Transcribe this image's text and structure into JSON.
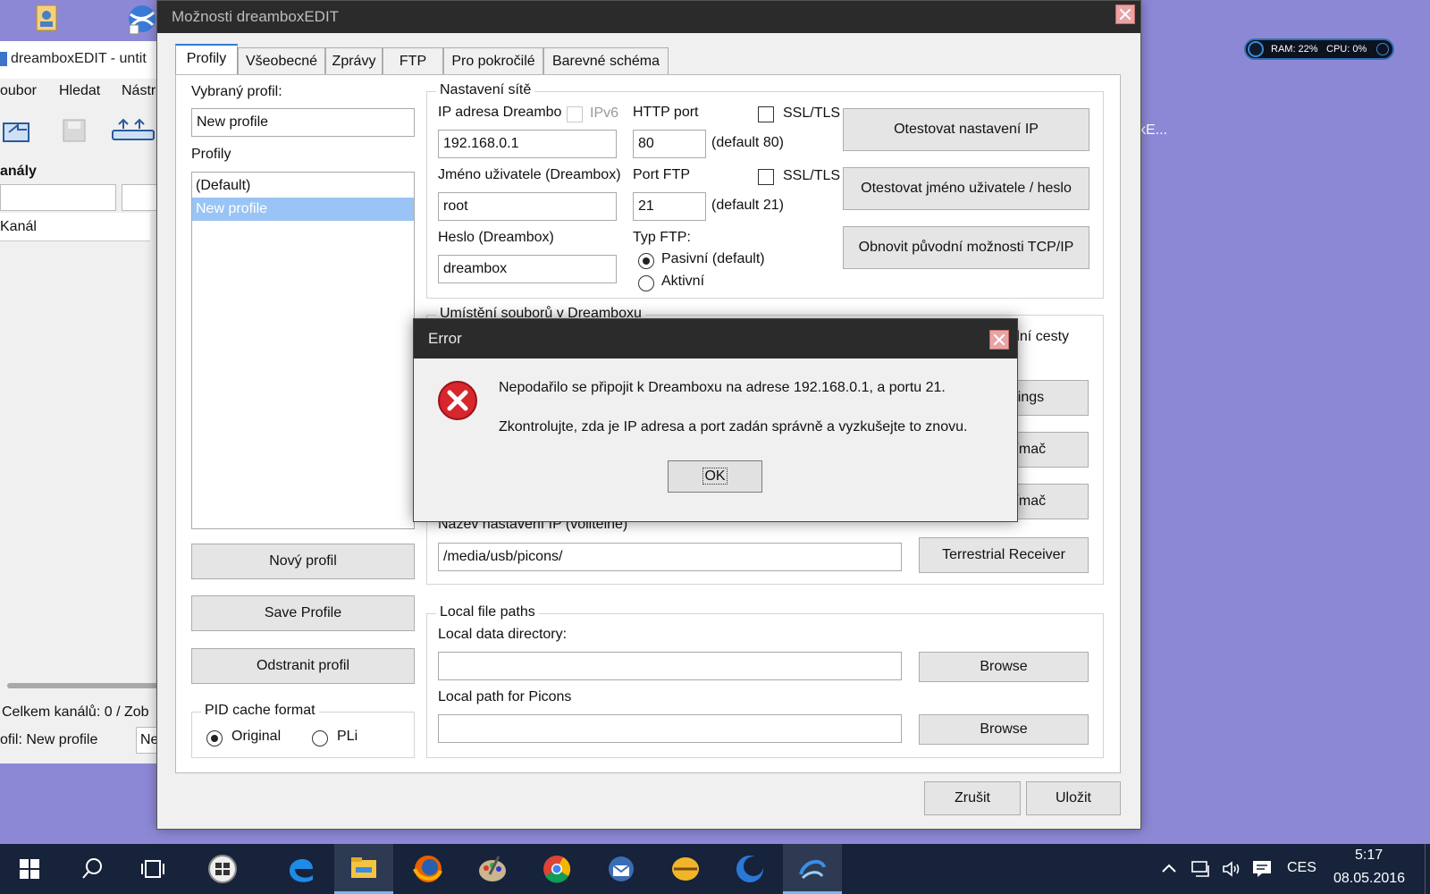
{
  "sysmon": {
    "ram": "RAM: 22%",
    "cpu": "CPU: 0%"
  },
  "desktop": {
    "partial_text": "kE..."
  },
  "bg_app": {
    "title": "dreamboxEDIT - untit",
    "menu": [
      "oubor",
      "Hledat",
      "Nástr"
    ],
    "section": "anály",
    "column": "Kanál",
    "status1": "Celkem kanálů: 0  /  Zob",
    "status2": "ofil: New profile",
    "status2b": "Ne"
  },
  "dialog": {
    "title": "Možnosti dreamboxEDIT",
    "tabs": [
      "Profily",
      "Všeobecné",
      "Zprávy",
      "FTP",
      "Pro pokročilé",
      "Barevné schéma"
    ],
    "selected_profile_label": "Vybraný profil:",
    "selected_profile_value": "New profile",
    "profiles_label": "Profily",
    "profiles": [
      "(Default)",
      "New profile"
    ],
    "btn_new_profile": "Nový profil",
    "btn_save_profile": "Save Profile",
    "btn_remove_profile": "Odstranit profil",
    "pid_group": "PID cache format",
    "pid_original": "Original",
    "pid_pli": "PLi",
    "net_group": "Nastavení sítě",
    "ip_label": "IP adresa Dreambo",
    "ipv6_label": "IPv6",
    "ip_value": "192.168.0.1",
    "http_port_label": "HTTP port",
    "ssl_label": "SSL/TLS",
    "http_port_value": "80",
    "http_default": "(default 80)",
    "user_label": "Jméno uživatele (Dreambox)",
    "user_value": "root",
    "ftp_port_label": "Port FTP",
    "ftp_port_value": "21",
    "ftp_default": "(default 21)",
    "pass_label": "Heslo (Dreambox)",
    "pass_value": "dreambox",
    "ftp_type_label": "Typ FTP:",
    "ftp_passive": "Pasivní (default)",
    "ftp_active": "Aktivní",
    "btn_test_ip": "Otestovat nastavení IP",
    "btn_test_user": "Otestovat jméno uživatele / heslo",
    "btn_restore_tcp": "Obnovit původní možnosti TCP/IP",
    "loc_group": "Umístění souborů v Dreamboxu",
    "partial_default_paths": "dní cesty",
    "partial_settings": "ettings",
    "partial_receiver1": "řijímač",
    "partial_receiver2": "řijímač",
    "ip_name_label": "Název nastavení IP (volitelné)",
    "ip_name_value": "/media/usb/picons/",
    "btn_terrestrial": "Terrestrial Receiver",
    "local_group": "Local file paths",
    "local_data_label": "Local data directory:",
    "local_data_value": "",
    "btn_browse1": "Browse",
    "local_picons_label": "Local path for Picons",
    "local_picons_value": "",
    "btn_browse2": "Browse",
    "btn_cancel": "Zrušit",
    "btn_save": "Uložit"
  },
  "error": {
    "title": "Error",
    "message1": "Nepodařilo se připojit k Dreamboxu na adrese 192.168.0.1, a portu 21.",
    "message2": "Zkontrolujte, zda je IP adresa a port zadán správně a vyzkušejte to znovu.",
    "ok": "OK"
  },
  "taskbar": {
    "language": "CES",
    "time": "5:17",
    "date": "08.05.2016"
  },
  "colors": {
    "accent": "#2f7bd1",
    "selection": "#99c4f5",
    "taskbar": "#16233a",
    "desktop": "#8d88d6",
    "error_red": "#d7262d"
  },
  "icons": [
    "windows-start-icon",
    "search-icon",
    "task-view-icon",
    "edge-icon",
    "file-explorer-icon",
    "firefox-icon",
    "paint-icon",
    "chrome-icon",
    "thunderbird-icon",
    "app-icon",
    "moon-icon",
    "dreambox-icon",
    "chevron-up-icon",
    "network-icon",
    "volume-icon",
    "notifications-icon",
    "error-icon"
  ]
}
